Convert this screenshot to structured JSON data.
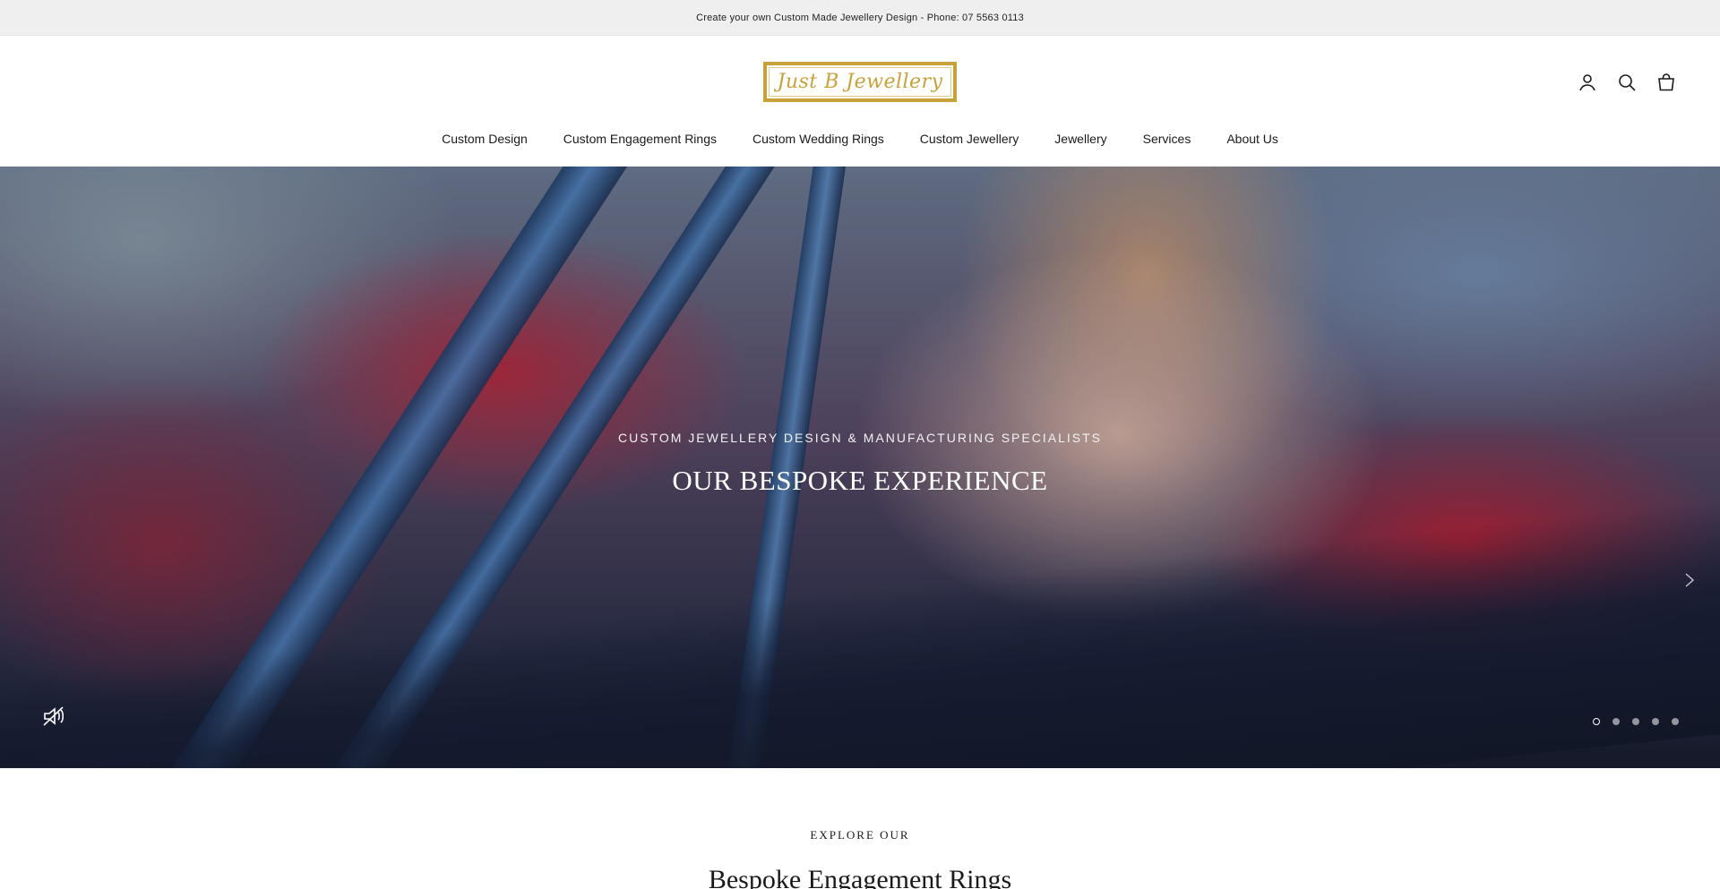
{
  "announcement": {
    "text": "Create your own Custom Made Jewellery Design - Phone: 07 5563 0113"
  },
  "header": {
    "logo_text": "Just B Jewellery",
    "icons": [
      "account-icon",
      "search-icon",
      "cart-icon"
    ]
  },
  "nav": {
    "items": [
      {
        "label": "Custom Design"
      },
      {
        "label": "Custom Engagement Rings"
      },
      {
        "label": "Custom Wedding Rings"
      },
      {
        "label": "Custom Jewellery"
      },
      {
        "label": "Jewellery"
      },
      {
        "label": "Services"
      },
      {
        "label": "About Us"
      }
    ]
  },
  "hero": {
    "eyebrow": "CUSTOM JEWELLERY DESIGN & MANUFACTURING SPECIALISTS",
    "title": "OUR BESPOKE EXPERIENCE",
    "slide_count": 5,
    "active_slide": 1,
    "sound": "muted"
  },
  "section": {
    "eyebrow": "EXPLORE OUR",
    "title": "Bespoke Engagement Rings"
  },
  "colors": {
    "announcement_bg": "#efefef",
    "logo_gold": "#c9a13a",
    "text": "#1a1a1a"
  }
}
